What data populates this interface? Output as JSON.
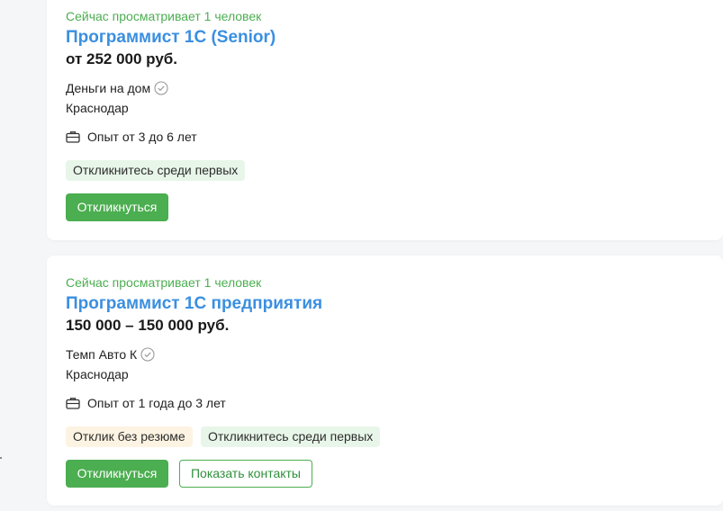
{
  "vacancies": [
    {
      "viewers": "Сейчас просматривает 1 человек",
      "title": "Программист 1С (Senior)",
      "salary": "от 252 000 руб.",
      "company": "Деньги на дом",
      "city": "Краснодар",
      "experience": "Опыт от 3 до 6 лет",
      "badges": [
        "Откликнитесь среди первых"
      ],
      "respond_button": "Откликнуться"
    },
    {
      "viewers": "Сейчас просматривает 1 человек",
      "title": "Программист 1С предприятия",
      "salary": "150 000 – 150 000 руб.",
      "company": "Темп Авто К",
      "city": "Краснодар",
      "experience": "Опыт от 1 года до 3 лет",
      "badges": [
        "Отклик без резюме",
        "Откликнитесь среди первых"
      ],
      "respond_button": "Откликнуться",
      "contacts_button": "Показать контакты"
    }
  ],
  "icons": {
    "verified": "check-circle-icon",
    "experience": "briefcase-icon"
  },
  "colors": {
    "accent_green": "#4bae50",
    "title_blue": "#3b8fe0",
    "badge_green_bg": "#e8f6e9",
    "badge_orange_bg": "#fdf3e2"
  }
}
